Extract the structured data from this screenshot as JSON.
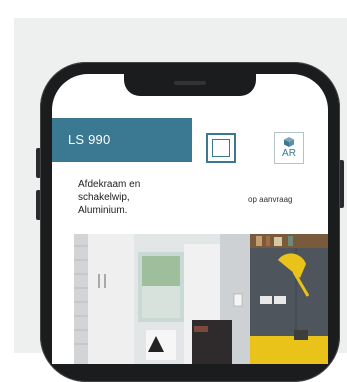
{
  "product": {
    "model": "LS 990",
    "description": "Afdekraam en\nschakelwip,\nAluminium.",
    "availability": "op aanvraag"
  },
  "ar_button": {
    "label": "AR"
  },
  "colors": {
    "accent": "#3a7991",
    "backdrop": "#eef0f0",
    "phone_frame": "#1b1c1e",
    "room_yellow": "#e9c21a"
  },
  "icons": {
    "switch": "rocker-switch-icon",
    "ar": "ar-cube-icon"
  }
}
